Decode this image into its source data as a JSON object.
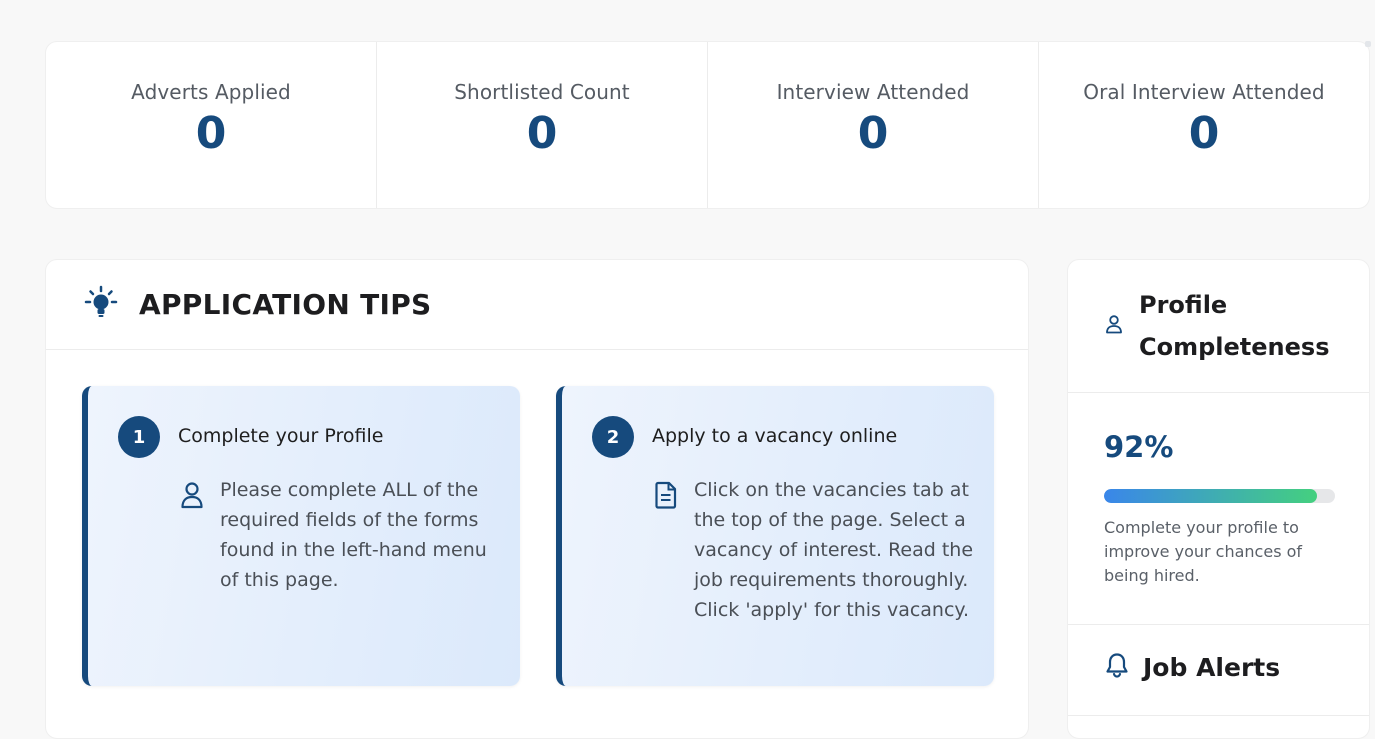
{
  "stats": [
    {
      "label": "Adverts Applied",
      "value": "0"
    },
    {
      "label": "Shortlisted Count",
      "value": "0"
    },
    {
      "label": "Interview Attended",
      "value": "0"
    },
    {
      "label": "Oral Interview Attended",
      "value": "0"
    }
  ],
  "tips": {
    "title": "APPLICATION TIPS",
    "icon": "lightbulb-icon",
    "items": [
      {
        "number": "1",
        "heading": "Complete your Profile",
        "icon": "user-icon",
        "body": "Please complete ALL of the required fields of the forms found in the left-hand menu of this page."
      },
      {
        "number": "2",
        "heading": "Apply to a vacancy online",
        "icon": "document-icon",
        "body": "Click on the vacancies tab at the top of the page. Select a vacancy of interest. Read the job requirements thoroughly. Click 'apply' for this vacancy."
      }
    ]
  },
  "profile": {
    "title": "Profile Completeness",
    "icon": "user-icon",
    "percent_label": "92%",
    "percent_value": 92,
    "note": "Complete your profile to improve your chances of being hired."
  },
  "alerts": {
    "title": "Job Alerts",
    "icon": "bell-icon"
  },
  "colors": {
    "brand": "#164a7d",
    "progress_start": "#3a86ea",
    "progress_end": "#44d07f"
  }
}
